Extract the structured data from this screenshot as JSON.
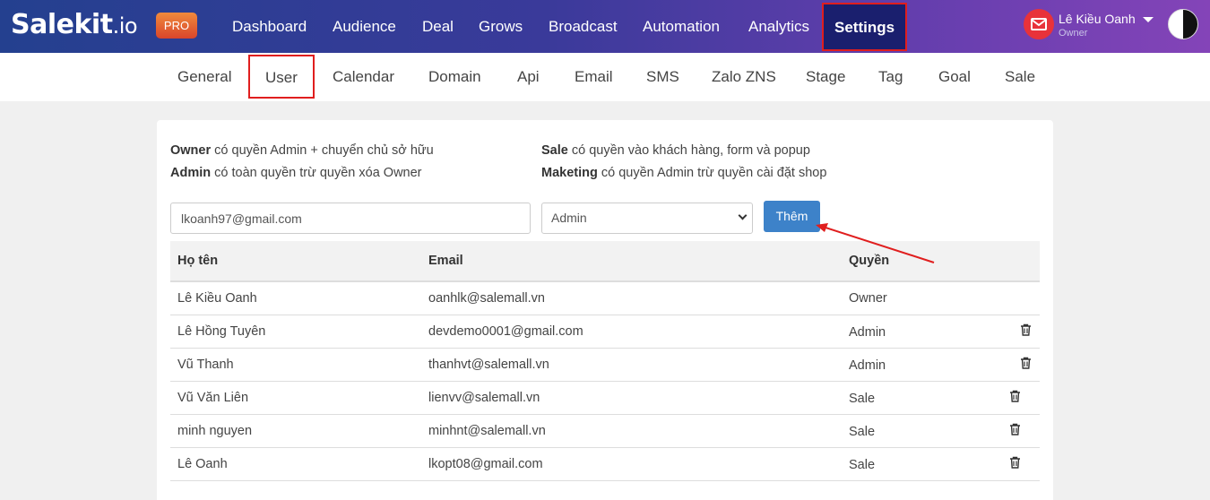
{
  "brand": {
    "logo_main": "Salekit",
    "logo_suffix": ".io",
    "badge": "PRO"
  },
  "nav": {
    "items": [
      "Dashboard",
      "Audience",
      "Deal",
      "Grows",
      "Broadcast",
      "Automation",
      "Analytics",
      "Settings"
    ],
    "active": "Settings"
  },
  "user": {
    "name": "Lê Kiều Oanh",
    "role": "Owner"
  },
  "subnav": {
    "items": [
      "General",
      "User",
      "Calendar",
      "Domain",
      "Api",
      "Email",
      "SMS",
      "Zalo ZNS",
      "Stage",
      "Tag",
      "Goal",
      "Sale"
    ],
    "active": "User"
  },
  "roles_info": {
    "owner": {
      "title": "Owner",
      "desc": "có quyền Admin + chuyển chủ sở hữu"
    },
    "admin": {
      "title": "Admin",
      "desc": "có toàn quyền trừ quyền xóa Owner"
    },
    "sale": {
      "title": "Sale",
      "desc": "có quyền vào khách hàng, form và popup"
    },
    "maketing": {
      "title": "Maketing",
      "desc": "có quyền Admin trừ quyền cài đặt shop"
    }
  },
  "form": {
    "email_value": "lkoanh97@gmail.com",
    "role_selected": "Admin",
    "add_label": "Thêm"
  },
  "table": {
    "headers": [
      "Họ tên",
      "Email",
      "Quyền"
    ],
    "rows": [
      {
        "name": "Lê Kiều Oanh",
        "email": "oanhlk@salemall.vn",
        "role": "Owner",
        "deletable": false
      },
      {
        "name": "Lê Hồng Tuyên",
        "email": "devdemo0001@gmail.com",
        "role": "Admin",
        "deletable": true
      },
      {
        "name": "Vũ Thanh",
        "email": "thanhvt@salemall.vn",
        "role": "Admin",
        "deletable": true
      },
      {
        "name": "Vũ Văn Liên",
        "email": "lienvv@salemall.vn",
        "role": "Sale",
        "deletable": true
      },
      {
        "name": "minh nguyen",
        "email": "minhnt@salemall.vn",
        "role": "Sale",
        "deletable": true
      },
      {
        "name": "Lê Oanh",
        "email": "lkopt08@gmail.com",
        "role": "Sale",
        "deletable": true
      }
    ]
  },
  "colors": {
    "accent": "#3d82c9",
    "highlight": "#e01e1e",
    "nav_active_bg": "#1a1f6e"
  }
}
